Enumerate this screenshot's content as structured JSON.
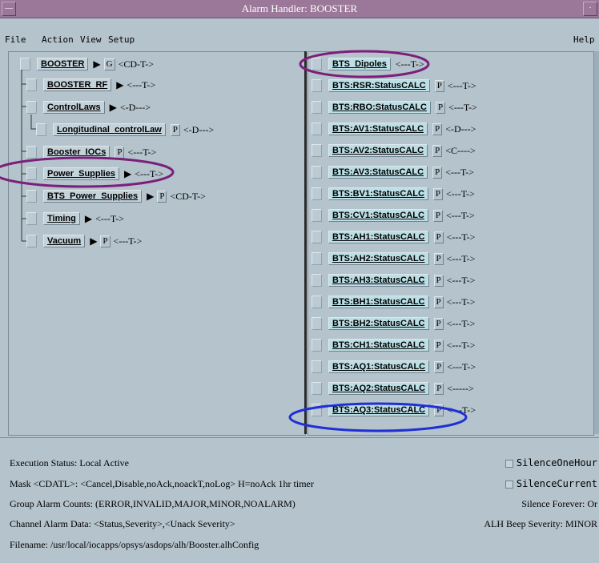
{
  "window": {
    "title": "Alarm Handler: BOOSTER"
  },
  "menu": {
    "file": "File",
    "action": "Action",
    "view": "View",
    "setup": "Setup",
    "help": "Help"
  },
  "groups": [
    {
      "name": "BOOSTER",
      "g": "G",
      "mask": "<CD-T->"
    },
    {
      "name": "BOOSTER_RF",
      "mask": "<---T->"
    },
    {
      "name": "ControlLaws",
      "mask": "<-D--->"
    },
    {
      "name": "Longitudinal_controlLaw",
      "p": "P",
      "mask": "<-D--->"
    },
    {
      "name": "Booster_IOCs",
      "p": "P",
      "mask": "<---T->"
    },
    {
      "name": "Power_Supplies",
      "mask": "<---T->"
    },
    {
      "name": "BTS_Power_Supplies",
      "p": "P",
      "mask": "<CD-T->"
    },
    {
      "name": "Timing",
      "mask": "<---T->"
    },
    {
      "name": "Vacuum",
      "p": "P",
      "mask": "<---T->"
    }
  ],
  "channels": [
    {
      "name": "BTS_Dipoles",
      "mask": "<---T->"
    },
    {
      "name": "BTS:RSR:StatusCALC",
      "p": "P",
      "mask": "<---T->"
    },
    {
      "name": "BTS:RBO:StatusCALC",
      "p": "P",
      "mask": "<---T->"
    },
    {
      "name": "BTS:AV1:StatusCALC",
      "p": "P",
      "mask": "<-D--->"
    },
    {
      "name": "BTS:AV2:StatusCALC",
      "p": "P",
      "mask": "<C---->"
    },
    {
      "name": "BTS:AV3:StatusCALC",
      "p": "P",
      "mask": "<---T->"
    },
    {
      "name": "BTS:BV1:StatusCALC",
      "p": "P",
      "mask": "<---T->"
    },
    {
      "name": "BTS:CV1:StatusCALC",
      "p": "P",
      "mask": "<---T->"
    },
    {
      "name": "BTS:AH1:StatusCALC",
      "p": "P",
      "mask": "<---T->"
    },
    {
      "name": "BTS:AH2:StatusCALC",
      "p": "P",
      "mask": "<---T->"
    },
    {
      "name": "BTS:AH3:StatusCALC",
      "p": "P",
      "mask": "<---T->"
    },
    {
      "name": "BTS:BH1:StatusCALC",
      "p": "P",
      "mask": "<---T->"
    },
    {
      "name": "BTS:BH2:StatusCALC",
      "p": "P",
      "mask": "<---T->"
    },
    {
      "name": "BTS:CH1:StatusCALC",
      "p": "P",
      "mask": "<---T->"
    },
    {
      "name": "BTS:AQ1:StatusCALC",
      "p": "P",
      "mask": "<---T->"
    },
    {
      "name": "BTS:AQ2:StatusCALC",
      "p": "P",
      "mask": "<----->"
    },
    {
      "name": "BTS:AQ3:StatusCALC",
      "p": "P",
      "mask": "<---T->"
    }
  ],
  "status": {
    "execution": "Execution Status:  Local Active",
    "mask": "Mask <CDATL>:  <Cancel,Disable,noAck,noackT,noLog>     H=noAck 1hr timer",
    "group_counts": "Group Alarm Counts:  (ERROR,INVALID,MAJOR,MINOR,NOALARM)",
    "channel_data": "Channel Alarm Data:  <Status,Severity>,<Unack Severity>",
    "filename": "Filename:   /usr/local/iocapps/opsys/asdops/alh/Booster.alhConfig",
    "silence_one_hour": "SilenceOneHour",
    "silence_current": "SilenceCurrent",
    "silence_forever": "Silence Forever:  Or",
    "beep_severity": "ALH Beep Severity:  MINOR"
  },
  "annotations": {
    "purple": "#7c1f7a",
    "blue": "#1f2fd6"
  }
}
